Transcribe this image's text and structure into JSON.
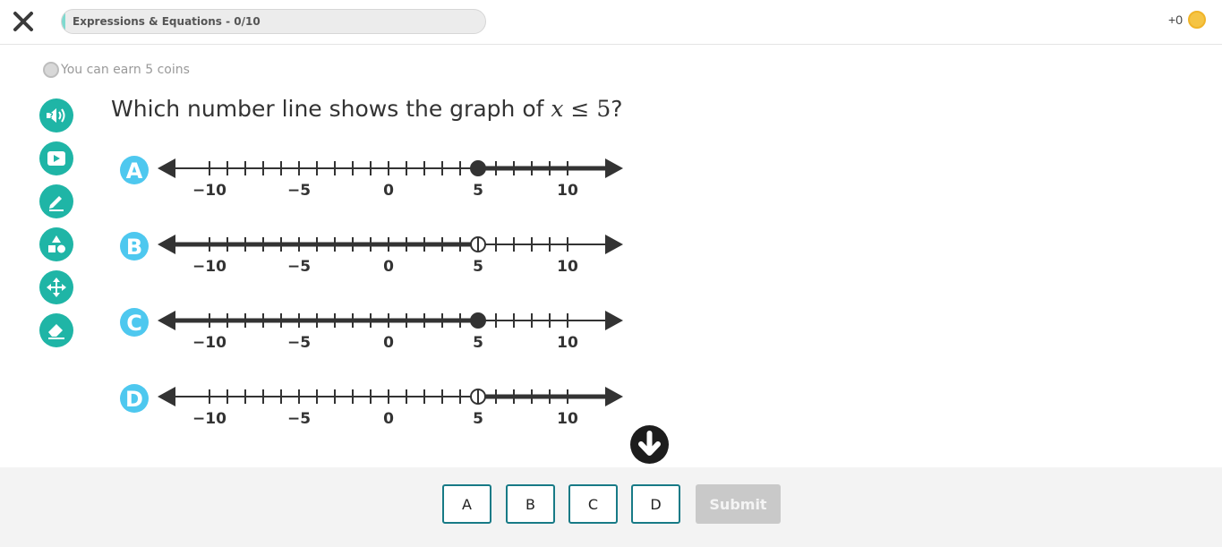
{
  "header": {
    "progress_label": "Expressions & Equations - 0/10",
    "coins_label": "+0",
    "icons": {
      "close": "close-icon",
      "coin": "coin-icon"
    }
  },
  "earn": {
    "text": "You can earn 5 coins"
  },
  "tools": [
    "read-aloud-icon",
    "play-video-icon",
    "pencil-icon",
    "shapes-icon",
    "move-icon",
    "eraser-icon"
  ],
  "question": {
    "prefix": "Which number line shows the graph of ",
    "var": "x",
    "op": "≤",
    "num": "5",
    "suffix": "?"
  },
  "number_line": {
    "min": -11,
    "max": 11,
    "labels": [
      {
        "value": -10,
        "text": "−10"
      },
      {
        "value": -5,
        "text": "−5"
      },
      {
        "value": 0,
        "text": "0"
      },
      {
        "value": 5,
        "text": "5"
      },
      {
        "value": 10,
        "text": "10"
      }
    ]
  },
  "options": [
    {
      "letter": "A",
      "point": 5,
      "closed": true,
      "direction": "right"
    },
    {
      "letter": "B",
      "point": 5,
      "closed": false,
      "direction": "left"
    },
    {
      "letter": "C",
      "point": 5,
      "closed": true,
      "direction": "left"
    },
    {
      "letter": "D",
      "point": 5,
      "closed": false,
      "direction": "right"
    }
  ],
  "answers": [
    "A",
    "B",
    "C",
    "D"
  ],
  "submit_label": "Submit",
  "colors": {
    "teal": "#1fb5a6",
    "letter_badge": "#4ec8ef",
    "line": "#333333",
    "answer_border": "#177a86"
  }
}
